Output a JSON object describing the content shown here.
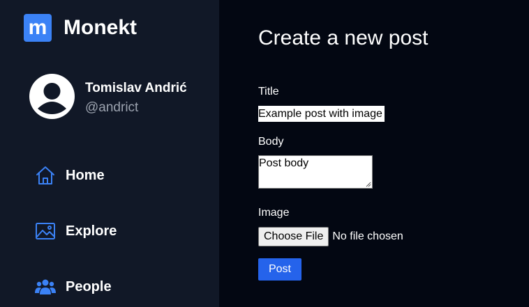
{
  "brand": {
    "name": "Monekt",
    "logo_letter": "m",
    "logo_color": "#3b82f6"
  },
  "profile": {
    "name": "Tomislav Andrić",
    "handle": "@andrict",
    "avatar_icon": "user-circle-icon"
  },
  "nav": [
    {
      "label": "Home",
      "icon": "home-icon"
    },
    {
      "label": "Explore",
      "icon": "image-icon"
    },
    {
      "label": "People",
      "icon": "people-icon"
    }
  ],
  "form": {
    "heading": "Create a new post",
    "title_label": "Title",
    "title_value": "Example post with image",
    "body_label": "Body",
    "body_value": "Post body",
    "image_label": "Image",
    "file_button_label": "Choose File",
    "file_status": "No file chosen",
    "submit_label": "Post"
  },
  "colors": {
    "sidebar_bg": "#111827",
    "main_bg": "#030712",
    "accent": "#2563eb",
    "nav_icon": "#3b82f6",
    "muted_text": "#9ca3af"
  }
}
